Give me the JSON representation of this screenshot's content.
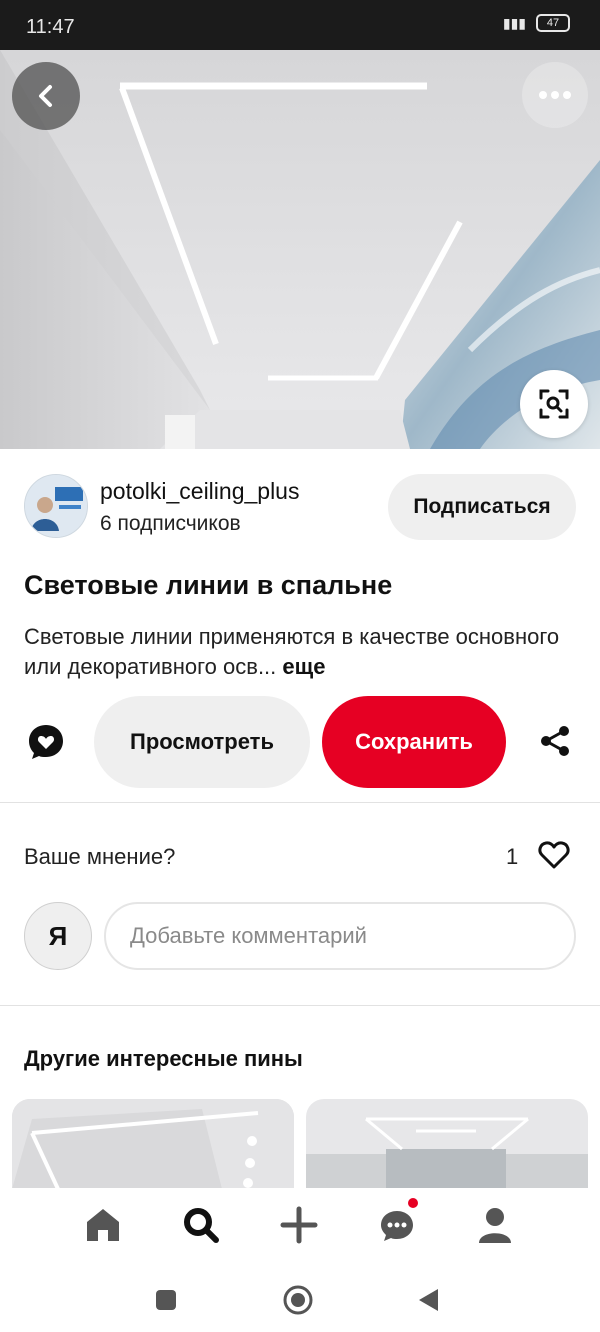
{
  "status_bar": {
    "time": "11:47",
    "battery": "47"
  },
  "author": {
    "name": "potolki_ceiling_plus",
    "subscribers": "6 подписчиков",
    "follow_label": "Подписаться"
  },
  "pin": {
    "title": "Световые линии в спальне",
    "description": "Световые линии применяются в качестве основного или декоративного осв...",
    "more_label": "еще"
  },
  "actions": {
    "view_label": "Просмотреть",
    "save_label": "Сохранить"
  },
  "comments": {
    "prompt": "Ваше мнение?",
    "like_count": "1",
    "user_initial": "Я",
    "input_placeholder": "Добавьте комментарий"
  },
  "related": {
    "title": "Другие интересные пины"
  },
  "icons": {
    "back": "chevron-left-icon",
    "more": "ellipsis-icon",
    "lens": "visual-search-icon",
    "comment": "comment-heart-icon",
    "share": "share-icon",
    "like": "heart-outline-icon",
    "nav_home": "home-icon",
    "nav_search": "search-icon",
    "nav_create": "plus-icon",
    "nav_messages": "chat-icon",
    "nav_profile": "profile-icon"
  },
  "colors": {
    "accent": "#e60023",
    "notification_dot": "#e60023"
  }
}
